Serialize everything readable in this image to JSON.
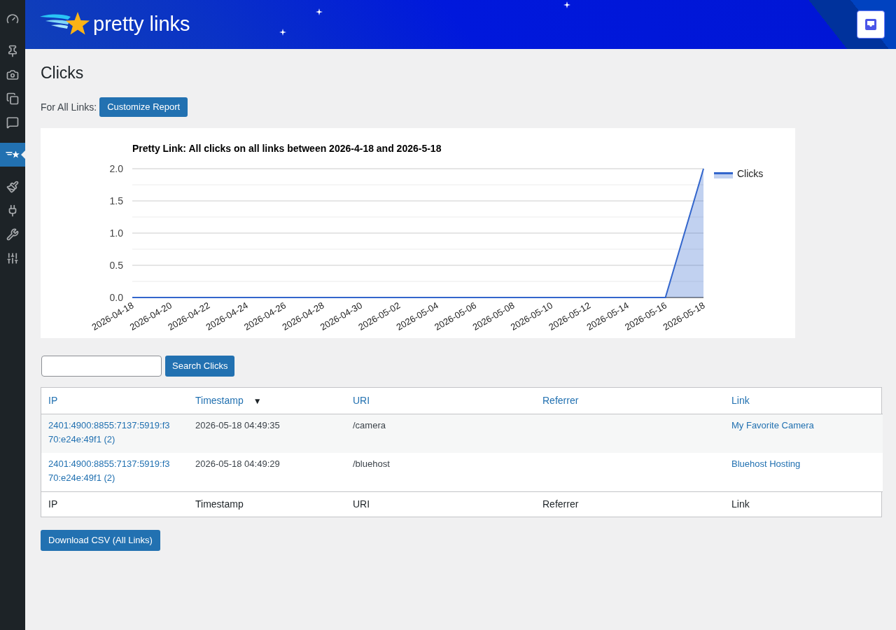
{
  "sidebar": {
    "groups": [
      {
        "items": [
          {
            "selected": false
          }
        ]
      },
      {
        "items": [
          {
            "selected": false
          },
          {
            "selected": false
          },
          {
            "selected": false
          },
          {
            "selected": false
          }
        ]
      },
      {
        "items": [
          {
            "selected": true
          }
        ]
      },
      {
        "items": [
          {
            "selected": false
          },
          {
            "selected": false
          },
          {
            "selected": false
          },
          {
            "selected": false
          }
        ]
      }
    ]
  },
  "header": {
    "logo_text": "pretty links"
  },
  "page": {
    "title": "Clicks",
    "filter_label": "For All Links:",
    "customize_button": "Customize Report"
  },
  "chart": {
    "chart_data": {
      "type": "area",
      "title": "Pretty Link: All clicks on all links between 2026-4-18 and 2026-5-18",
      "categories": [
        "2026-04-18",
        "2026-04-20",
        "2026-04-22",
        "2026-04-24",
        "2026-04-26",
        "2026-04-28",
        "2026-04-30",
        "2026-05-02",
        "2026-05-04",
        "2026-05-06",
        "2026-05-08",
        "2026-05-10",
        "2026-05-12",
        "2026-05-14",
        "2026-05-16",
        "2026-05-18"
      ],
      "series": [
        {
          "name": "Clicks",
          "color": "#3366cc",
          "values": [
            0,
            0,
            0,
            0,
            0,
            0,
            0,
            0,
            0,
            0,
            0,
            0,
            0,
            0,
            0,
            2
          ]
        }
      ],
      "ylim": [
        0,
        2
      ],
      "yticks": [
        {
          "value": 0,
          "label": "0.0"
        },
        {
          "value": 0.5,
          "label": "0.5"
        },
        {
          "value": 1,
          "label": "1.0"
        },
        {
          "value": 1.5,
          "label": "1.5"
        },
        {
          "value": 2,
          "label": "2.0"
        }
      ],
      "grid": true
    }
  },
  "search": {
    "button": "Search Clicks"
  },
  "table": {
    "columns": [
      {
        "label": "IP"
      },
      {
        "label": "Timestamp",
        "sort_indicator": "▼"
      },
      {
        "label": "URI"
      },
      {
        "label": "Referrer"
      },
      {
        "label": "Link"
      }
    ],
    "rows": [
      {
        "ip": "2401:4900:8855:7137:5919:f370:e24e:49f1 (2)",
        "timestamp": "2026-05-18 04:49:35",
        "uri": "/camera",
        "link": "My Favorite Camera"
      },
      {
        "ip": "2401:4900:8855:7137:5919:f370:e24e:49f1 (2)",
        "timestamp": "2026-05-18 04:49:29",
        "uri": "/bluehost",
        "link": "Bluehost Hosting"
      }
    ],
    "footer": [
      "IP",
      "Timestamp",
      "URI",
      "Referrer",
      "Link"
    ]
  },
  "download_button": "Download CSV (All Links)"
}
